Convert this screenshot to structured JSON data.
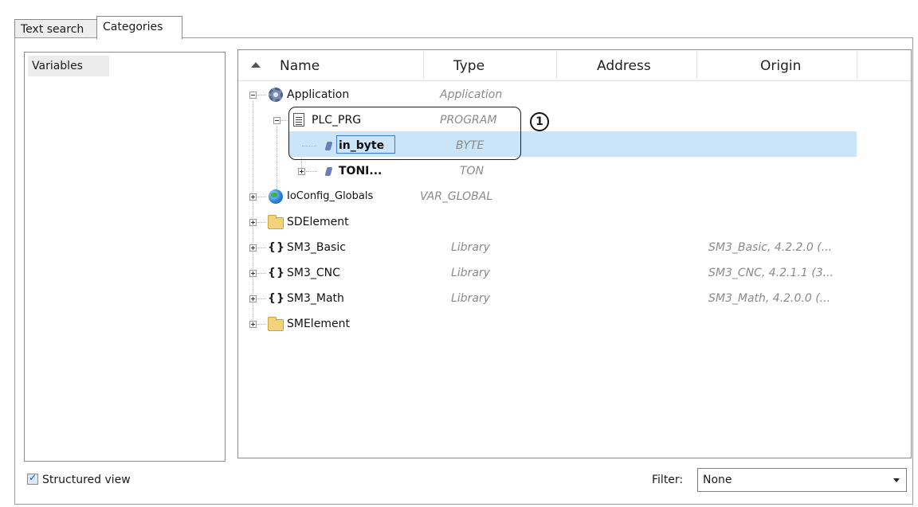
{
  "tabs": [
    {
      "label": "Text search"
    },
    {
      "label": "Categories"
    }
  ],
  "left_panel": {
    "items": [
      {
        "label": "Variables"
      }
    ]
  },
  "tree": {
    "columns": {
      "name": "Name",
      "type": "Type",
      "address": "Address",
      "origin": "Origin"
    },
    "rows": [
      {
        "name": "Application",
        "type": "Application",
        "origin": ""
      },
      {
        "name": "PLC_PRG",
        "type": "PROGRAM",
        "origin": ""
      },
      {
        "name": "in_byte",
        "type": "BYTE",
        "origin": ""
      },
      {
        "name": "TONI...",
        "type": "TON",
        "origin": ""
      },
      {
        "name": "IoConfig_Globals",
        "type": "VAR_GLOBAL",
        "origin": ""
      },
      {
        "name": "SDElement",
        "type": "",
        "origin": ""
      },
      {
        "name": "SM3_Basic",
        "type": "Library",
        "origin": "SM3_Basic, 4.2.2.0 (..."
      },
      {
        "name": "SM3_CNC",
        "type": "Library",
        "origin": "SM3_CNC, 4.2.1.1 (3..."
      },
      {
        "name": "SM3_Math",
        "type": "Library",
        "origin": "SM3_Math, 4.2.0.0 (..."
      },
      {
        "name": "SMElement",
        "type": "",
        "origin": ""
      }
    ],
    "selected_row": "in_byte",
    "annotation": "1"
  },
  "footer": {
    "structured_view_label": "Structured view",
    "structured_view_checked": true,
    "filter_label": "Filter:",
    "filter_value": "None"
  },
  "colors": {
    "selection": "#cce4f7",
    "muted_text": "#8a8a8a"
  }
}
